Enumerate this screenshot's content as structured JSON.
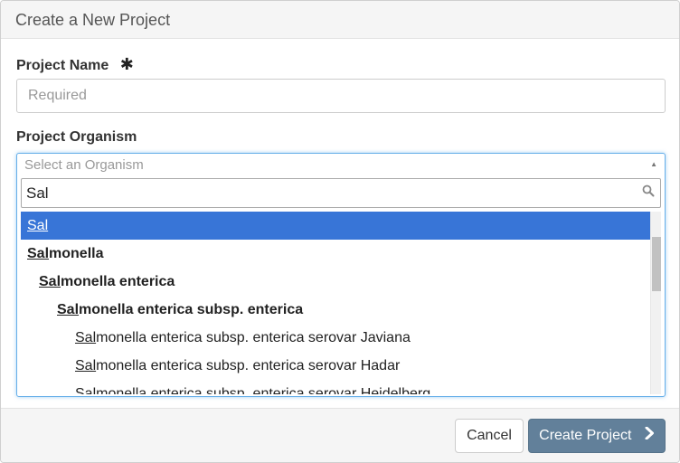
{
  "dialog": {
    "title": "Create a New Project"
  },
  "name_field": {
    "label": "Project Name",
    "required_mark": "✱",
    "placeholder": "Required"
  },
  "organism_field": {
    "label": "Project Organism",
    "select_placeholder": "Select an Organism",
    "search_value": "Sal",
    "results": [
      {
        "match": "Sal",
        "rest": "",
        "level": 0,
        "bold": false,
        "highlighted": true
      },
      {
        "match": "Sal",
        "rest": "monella",
        "level": 0,
        "bold": true,
        "highlighted": false
      },
      {
        "match": "Sal",
        "rest": "monella enterica",
        "level": 1,
        "bold": true,
        "highlighted": false
      },
      {
        "match": "Sal",
        "rest": "monella enterica subsp. enterica",
        "level": 2,
        "bold": true,
        "highlighted": false
      },
      {
        "match": "Sal",
        "rest": "monella enterica subsp. enterica serovar Javiana",
        "level": 3,
        "bold": false,
        "highlighted": false
      },
      {
        "match": "Sal",
        "rest": "monella enterica subsp. enterica serovar Hadar",
        "level": 3,
        "bold": false,
        "highlighted": false
      },
      {
        "match": "Sal",
        "rest": "monella enterica subsp. enterica serovar Heidelberg",
        "level": 3,
        "bold": false,
        "highlighted": false
      }
    ]
  },
  "footer": {
    "cancel_label": "Cancel",
    "create_label": "Create Project"
  },
  "icons": {
    "search": "search-icon",
    "chevron": "chevron-right-icon",
    "dropdown_arrow": "caret-up-icon"
  },
  "colors": {
    "highlight": "#3875d7",
    "primary_button": "#62809a",
    "focus_border": "#66afe9"
  }
}
